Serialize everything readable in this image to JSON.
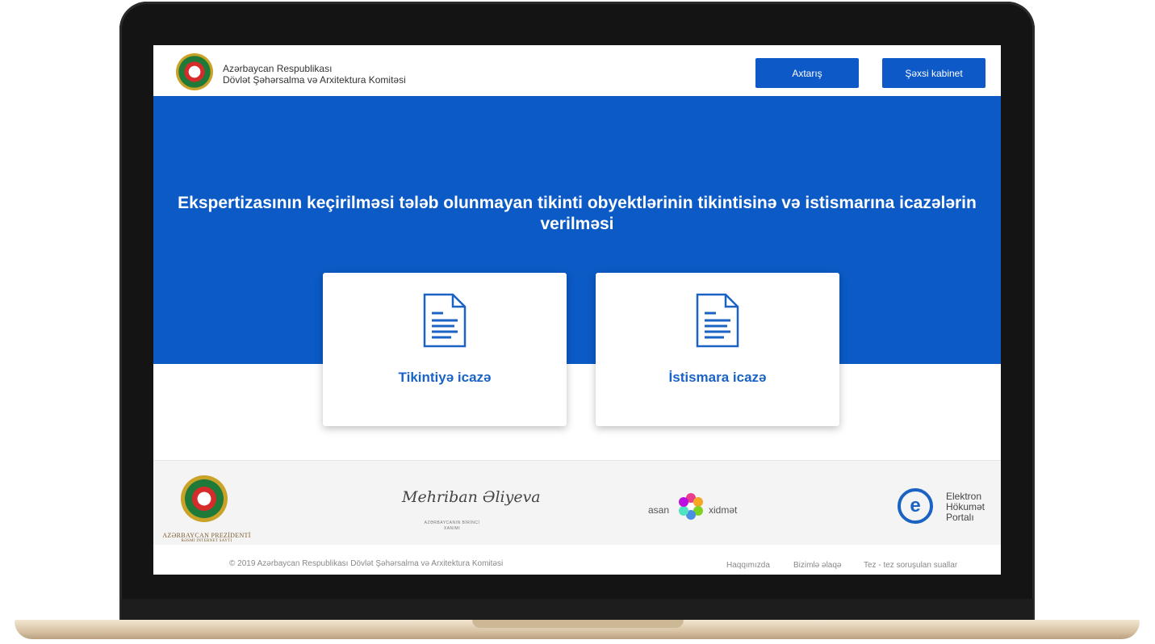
{
  "header": {
    "org_line_1": "Azərbaycan Respublikası",
    "org_line_2": "Dövlət Şəhərsalma və Arxitektura Komitəsi",
    "search_button": "Axtarış",
    "cabinet_button": "Şəxsi kabinet"
  },
  "hero": {
    "title": "Ekspertizasının keçirilməsi tələb olunmayan tikinti obyektlərinin tikintisinə və istismarına icazələrin verilməsi"
  },
  "cards": [
    {
      "label": "Tikintiyə icazə",
      "icon": "document-icon"
    },
    {
      "label": "İstismara icazə",
      "icon": "document-icon"
    }
  ],
  "partners": {
    "president_caption": "AZƏRBAYCAN PREZİDENTİ",
    "president_subcaption": "RƏSMİ İNTERNET SAYTI",
    "signature": "Mehriban Əliyeva",
    "signature_caption": "AZƏRBAYCANIN BİRİNCİ XANIMI",
    "asan_left": "asan",
    "asan_right": "xidmət",
    "egov_letter": "e",
    "egov_line_1": "Elektron",
    "egov_line_2": "Hökumət",
    "egov_line_3": "Portalı"
  },
  "footer": {
    "copyright": "© 2019 Azərbaycan Respublikası Dövlət Şəhərsalma və Arxitektura Komitəsi",
    "link_about": "Haqqımızda",
    "link_contact": "Bizimlə əlaqə",
    "link_faq": "Tez - tez soruşulan suallar"
  },
  "colors": {
    "brand_blue": "#0b5ac6",
    "card_text": "#1a63c4"
  }
}
